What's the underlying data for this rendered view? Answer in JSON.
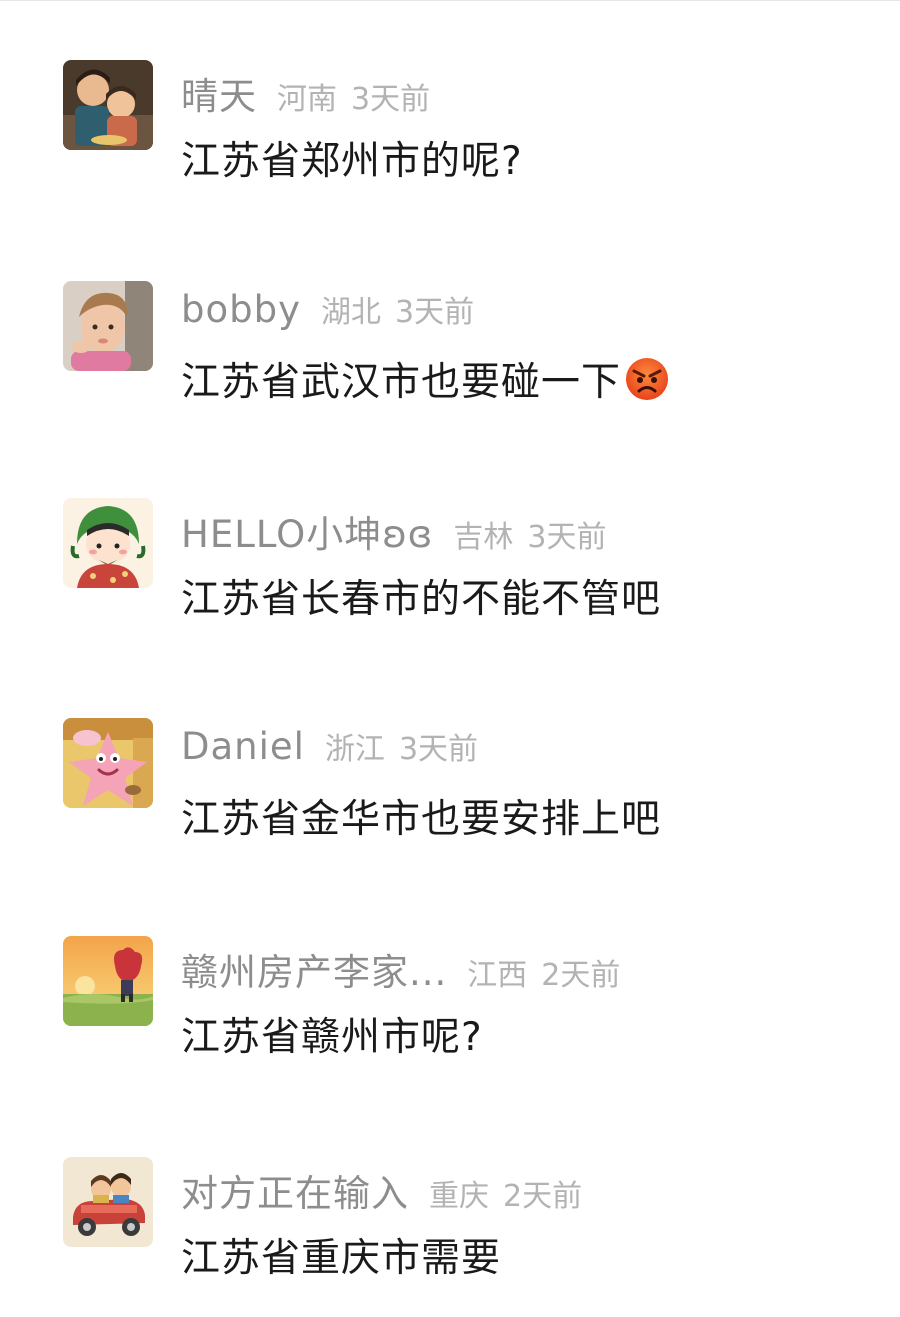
{
  "comments": [
    {
      "username": "晴天",
      "location": "河南",
      "time": "3天前",
      "content": "江苏省郑州市的呢?",
      "avatar_icon": "parent-child-cartoon-avatar"
    },
    {
      "username": "bobby",
      "location": "湖北",
      "time": "3天前",
      "content": "江苏省武汉市也要碰一下",
      "avatar_icon": "boy-photo-avatar",
      "emoji_icon": "angry-face-emoji"
    },
    {
      "username": "HELLO小坤ʚɞ",
      "location": "吉林",
      "time": "3天前",
      "content": "江苏省长春市的不能不管吧",
      "avatar_icon": "girl-green-headscarf-avatar"
    },
    {
      "username": "Daniel",
      "location": "浙江",
      "time": "3天前",
      "content": "江苏省金华市也要安排上吧",
      "avatar_icon": "patrick-star-avatar"
    },
    {
      "username": "赣州房产李家...",
      "location": "江西",
      "time": "2天前",
      "content": "江苏省赣州市呢?",
      "avatar_icon": "sunset-character-avatar"
    },
    {
      "username": "对方正在输入",
      "location": "重庆",
      "time": "2天前",
      "content": "江苏省重庆市需要",
      "avatar_icon": "cartoon-car-avatar"
    }
  ],
  "colors": {
    "username": "#8d8d8d",
    "meta": "#b3b3b3",
    "content": "#1a1a1a",
    "background": "#ffffff"
  }
}
